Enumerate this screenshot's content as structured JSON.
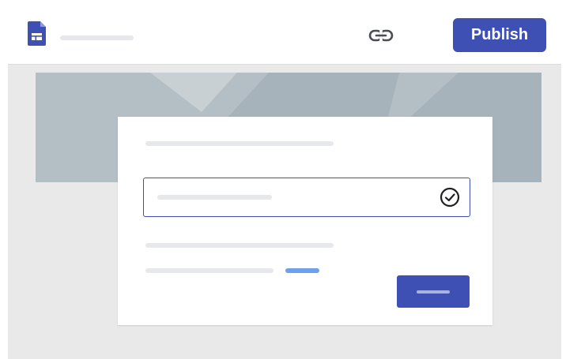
{
  "toolbar": {
    "publish_label": "Publish",
    "icons": {
      "app": "forms-document-icon",
      "link": "link-icon"
    }
  },
  "form": {
    "field_status_icon": "check-circle-icon"
  },
  "colors": {
    "accent": "#3f50b5",
    "link_accent": "#6da1ea",
    "banner": "#b3bec5",
    "background": "#e9e9ea",
    "skeleton": "#e6e8eb"
  }
}
